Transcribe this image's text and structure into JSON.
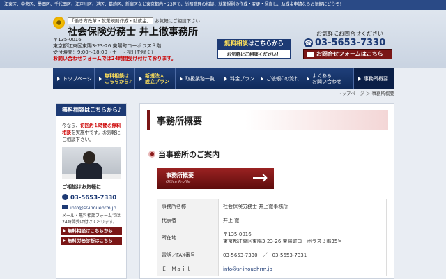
{
  "top_strip": "江東区、中央区、墨田区、千代田区、江戸川区、港区、葛飾区、新宿区など東京都内・23区で、労務管理の相談、就業規則の作成・変更・見直し、助成金申請ならお気軽にどうぞ！",
  "header": {
    "tagline_box": "「働き方改革・就業規則作成・助成金」",
    "tagline_rest": "お気軽にご相談下さい！",
    "company_name": "社会保険労務士 井上徹事務所",
    "postal": "〒135-0016",
    "address": "東京都江東区東陽3-23-26 東陽町コーポラス３階",
    "hours": "受付時間：9:00～18:00（土日・祝日を除く）",
    "form_note": "お問い合わせフォームでは24時間受け付けております。",
    "consult_top_highlight": "無料相談",
    "consult_top_rest": "はこちらから",
    "consult_bottom": "お気軽にご相談ください！",
    "contact_hint": "お気軽にお問合せください",
    "phone": "03-5653-7330",
    "phone_icon": "☎",
    "form_button": "お問合せフォームはこちら"
  },
  "nav": {
    "items": [
      {
        "label": "トップページ"
      },
      {
        "label1": "無料相談は",
        "label2": "こちらから♪"
      },
      {
        "label1": "新規法人",
        "label2": "設立プラン"
      },
      {
        "label": "取扱業務一覧"
      },
      {
        "label": "料金プラン"
      },
      {
        "label": "ご依頼ධの流れ"
      },
      {
        "label1": "よくある",
        "label2": "お問い合わせ"
      },
      {
        "label": "事務所概要"
      }
    ]
  },
  "breadcrumb": "トップページ ＞ 事務所概要",
  "sidebar": {
    "head": "無料相談はこちらから♪",
    "intro_1": "今なら、",
    "intro_red": "初回約１時間の無料相談",
    "intro_2": "を実施中です。お気軽にご相談下さい。",
    "contact_title": "ご相談はお気軽に",
    "phone": "03-5653-7330",
    "email": "info@sr-inouehrm.jp",
    "note": "メール・無料相談フォームでは24時間受け付けております。",
    "btn1": "無料相談はこちらから",
    "btn2": "無料労務診断はこちら"
  },
  "main": {
    "page_title": "事務所概要",
    "section_title": "当事務所のご案内",
    "banner_title": "事務所概要",
    "banner_sub": "Office Profile",
    "table": {
      "rows": [
        {
          "label": "事務所名称",
          "value": "社会保険労務士 井上徹事務所"
        },
        {
          "label": "代表者",
          "value": "井上 徹"
        },
        {
          "label": "所在地",
          "value": "〒135-0016",
          "value2": "東京都江東区東陽3-23-26 東陽町コーポラス３階35号"
        },
        {
          "label": "電話／FAX番号",
          "value": "03-5653-7330　／　03-5653-7331"
        },
        {
          "label": "Ｅ－Ｍａｉｌ",
          "value": "info@sr-inouehrm.jp"
        }
      ]
    }
  },
  "colors": {
    "navy": "#1d3a74",
    "maroon": "#7a1616",
    "red_text": "#cc0000"
  }
}
